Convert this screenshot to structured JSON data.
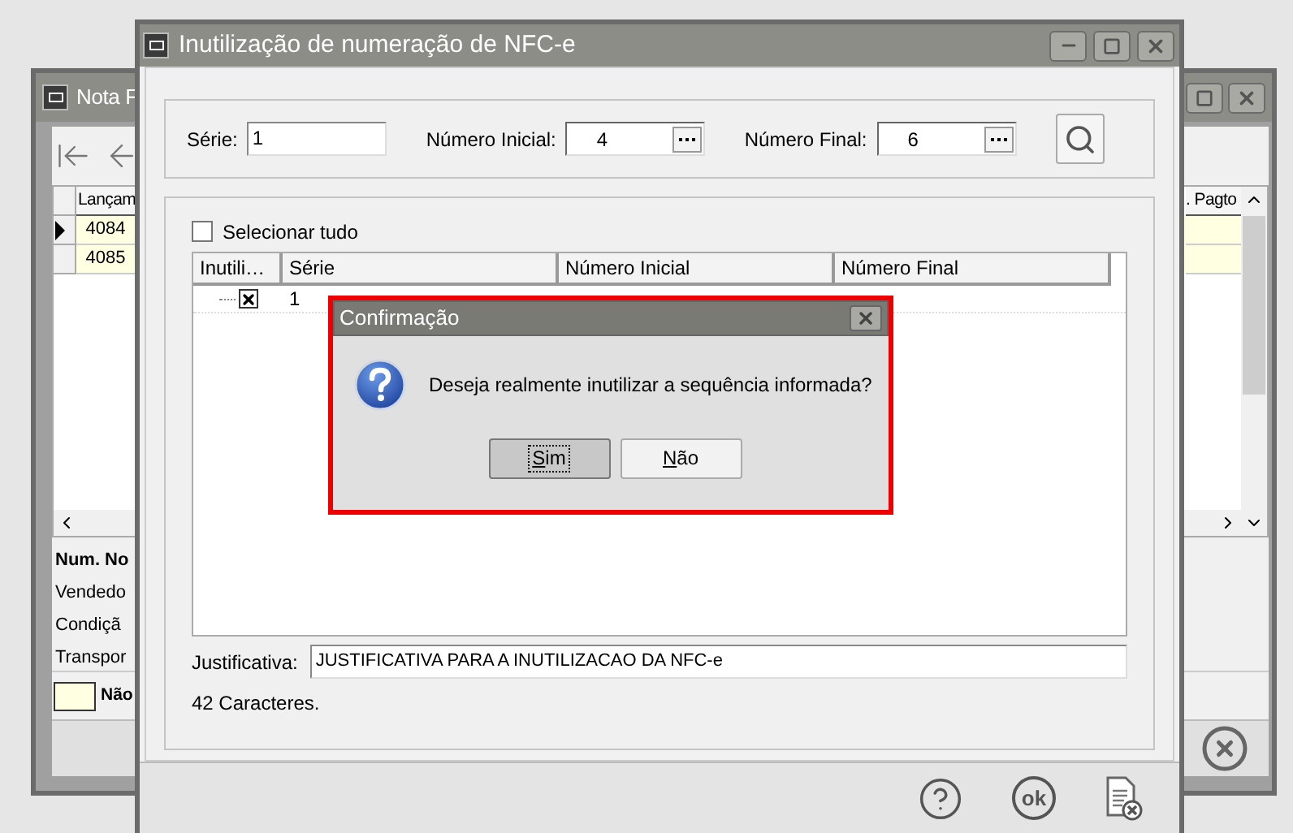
{
  "back_window": {
    "title": "Nota F",
    "grid": {
      "columns": [
        "Lançam",
        ". Pagto"
      ],
      "rows": [
        {
          "cells": [
            "4084"
          ],
          "selected": true
        },
        {
          "cells": [
            "4085"
          ],
          "selected": false
        }
      ]
    },
    "info_labels": [
      {
        "text": "Num. No",
        "bold": true
      },
      {
        "text": "Vendedo",
        "bold": false
      },
      {
        "text": "Condiçã",
        "bold": false
      },
      {
        "text": "Transpor",
        "bold": false
      }
    ],
    "legend": {
      "label": "Não",
      "color": "#ffffe1"
    }
  },
  "window": {
    "title": "Inutilização de numeração de NFC-e",
    "filters": [
      {
        "label": "Série:",
        "value": "1",
        "kind": "text"
      },
      {
        "label": "Número Inicial:",
        "value": "4",
        "kind": "lookup"
      },
      {
        "label": "Número Final:",
        "value": "6",
        "kind": "lookup"
      }
    ],
    "select_all": {
      "label": "Selecionar tudo",
      "checked": false
    },
    "table": {
      "columns": [
        "Inutili…",
        "Série",
        "Número Inicial",
        "Número Final"
      ],
      "rows": [
        {
          "checked": true,
          "cells": [
            "",
            "1"
          ]
        }
      ]
    },
    "justification": {
      "label": "Justificativa:",
      "value": "JUSTIFICATIVA PARA A INUTILIZACAO DA NFC-e"
    },
    "char_count": "42 Caracteres.",
    "actions": [
      {
        "kind": "help"
      },
      {
        "kind": "ok",
        "label": "ok"
      },
      {
        "kind": "cancel"
      }
    ]
  },
  "dialog": {
    "title": "Confirmação",
    "message": "Deseja realmente inutilizar a sequência informada?",
    "buttons": [
      {
        "label": "Sim",
        "focused": true
      },
      {
        "label": "Não",
        "focused": false
      }
    ]
  }
}
